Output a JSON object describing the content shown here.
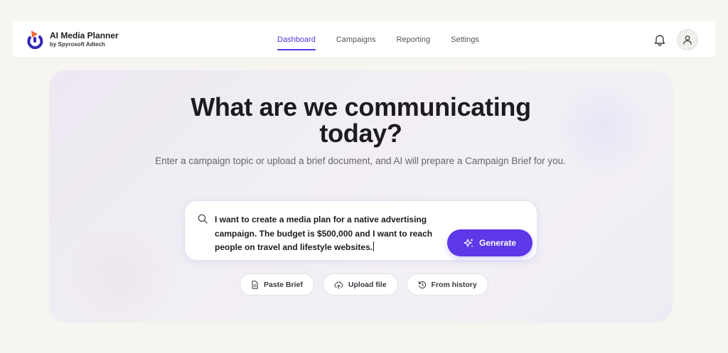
{
  "app": {
    "name": "AI Media Planner",
    "byline": "by Spyrosoft Adtech"
  },
  "nav": {
    "items": [
      {
        "label": "Dashboard",
        "active": true
      },
      {
        "label": "Campaigns",
        "active": false
      },
      {
        "label": "Reporting",
        "active": false
      },
      {
        "label": "Settings",
        "active": false
      }
    ]
  },
  "header_icons": [
    "bell-icon",
    "user-icon"
  ],
  "hero": {
    "headline": "What are we communicating today?",
    "subline": "Enter a campaign topic or upload a brief document, and AI will prepare a Campaign Brief for you."
  },
  "prompt": {
    "value": "I want to create a media plan for a native advertising campaign. The budget is $500,000 and I want to reach people on travel and lifestyle websites.",
    "generate_label": "Generate"
  },
  "actions": {
    "paste_brief": "Paste Brief",
    "upload_file": "Upload file",
    "from_history": "From history"
  },
  "colors": {
    "accent": "#5c38e8",
    "logo_orange": "#f26a3b",
    "logo_navy": "#3327b8"
  }
}
